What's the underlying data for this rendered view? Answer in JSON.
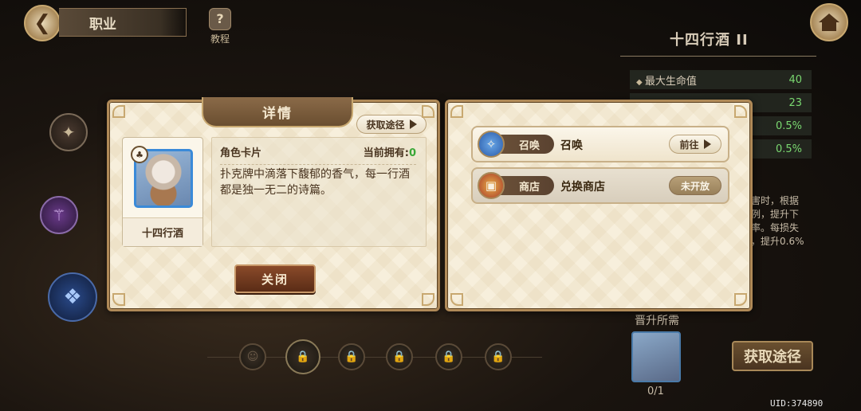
{
  "nav": {
    "back_icon": "arrow-left-icon",
    "title": "职业",
    "tutorial_label": "教程",
    "tutorial_icon": "question-icon",
    "home_icon": "house-icon"
  },
  "background": {
    "item_title": "十四行酒 II",
    "stats": [
      {
        "name": "最大生命值",
        "value": "40"
      },
      {
        "name": "",
        "value": "23"
      },
      {
        "name": "",
        "value": "0.5%"
      },
      {
        "name": "",
        "value": "0.5%"
      }
    ],
    "effect_text": "伤害时，根据\n比例，提升下\n击率。每损失\n值，提升0.6%",
    "promote_label": "晋升所需",
    "promote_count": "0/1",
    "get_path_button": "获取途径",
    "uid": "UID:374890"
  },
  "detail_panel": {
    "header": "详情",
    "acquire_button": "获取途径",
    "character_name": "十四行酒",
    "card_type": "角色卡片",
    "owned_label": "当前拥有:",
    "owned_value": "0",
    "description": "扑克牌中滴落下馥郁的香气，每一行酒都是独一无二的诗篇。",
    "close_button": "关闭"
  },
  "sources_panel": {
    "rows": [
      {
        "tag": "召唤",
        "name": "召唤",
        "button": "前往",
        "icon": "summon-icon",
        "enabled": true
      },
      {
        "tag": "商店",
        "name": "兑换商店",
        "button": "未开放",
        "icon": "shop-icon",
        "enabled": false
      }
    ]
  },
  "colors": {
    "panel_bg": "#f7efdc",
    "panel_border": "#b08a58",
    "header_tab": "#7a5a3c",
    "close_button": "#6a3a20",
    "owned_value": "#3aa838",
    "stat_value": "#7ad870"
  }
}
